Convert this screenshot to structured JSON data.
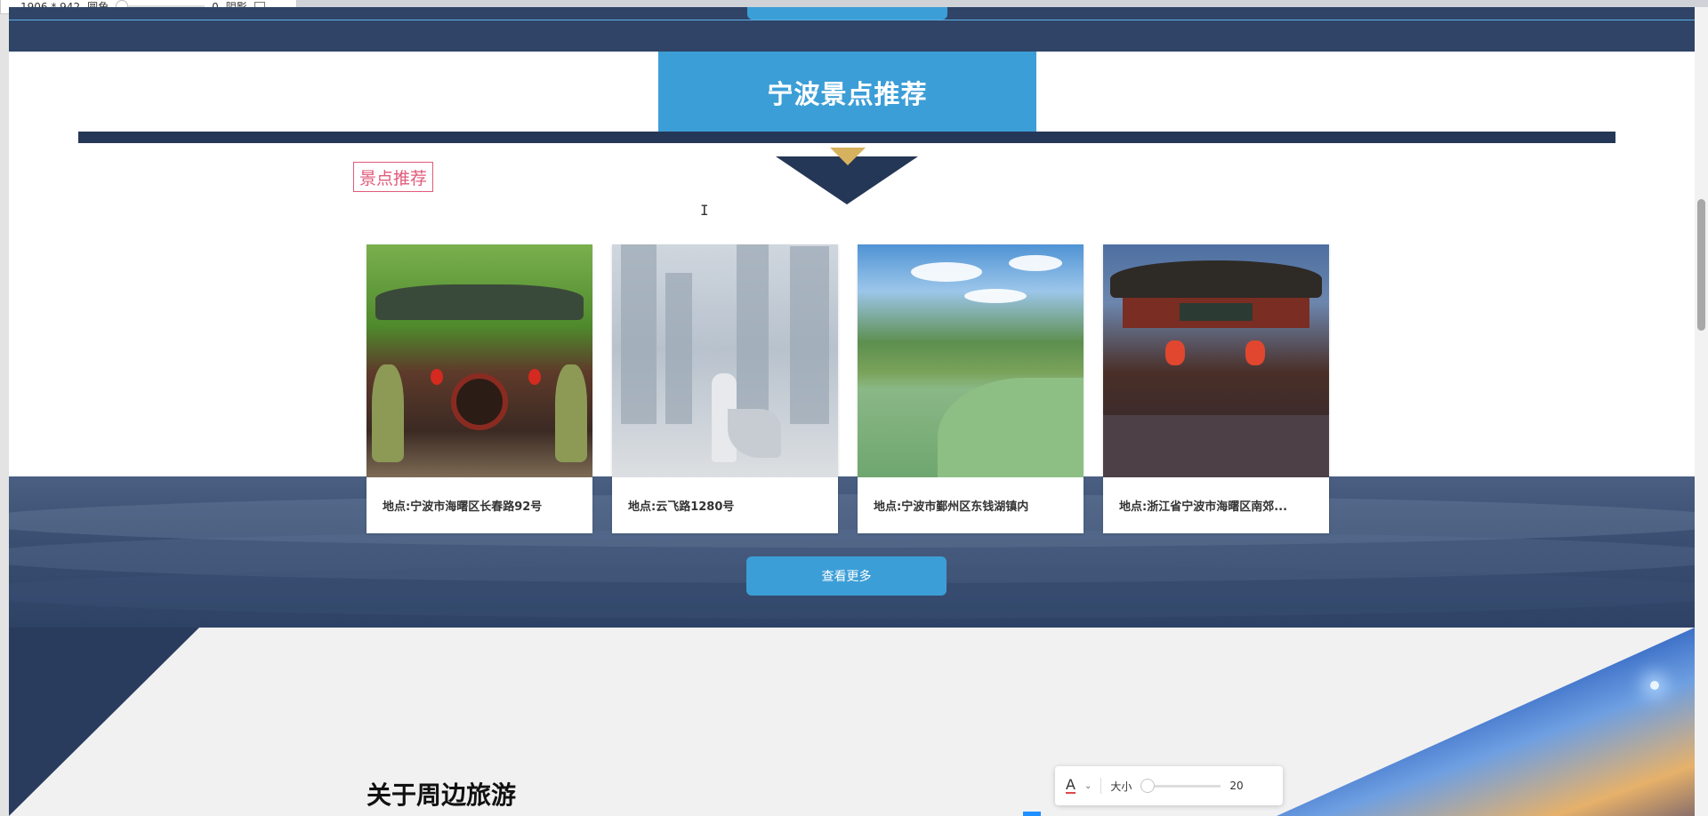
{
  "toolbar": {
    "dimensions": "1906 * 942",
    "radius_label": "圆角",
    "radius_value": "0",
    "shadow_label": "阴影"
  },
  "section": {
    "title": "宁波景点推荐",
    "tag": "景点推荐"
  },
  "spots": [
    {
      "caption": "地点:宁波市海曙区长春路92号",
      "icon": "temple-gate-photo"
    },
    {
      "caption": "地点:云飞路1280号",
      "icon": "misty-city-photo"
    },
    {
      "caption": "地点:宁波市鄞州区东钱湖镇内",
      "icon": "lake-landscape-photo"
    },
    {
      "caption": "地点:浙江省宁波市海曙区南郊...",
      "icon": "city-gate-photo"
    }
  ],
  "more_button": "查看更多",
  "about": {
    "title": "关于周边旅游"
  },
  "font_panel": {
    "size_label": "大小",
    "size_value": "20"
  },
  "colors": {
    "accent_blue": "#3c9ed7",
    "navy": "#253756",
    "gold": "#d6b25e",
    "tag_pink": "#e05a7a"
  }
}
